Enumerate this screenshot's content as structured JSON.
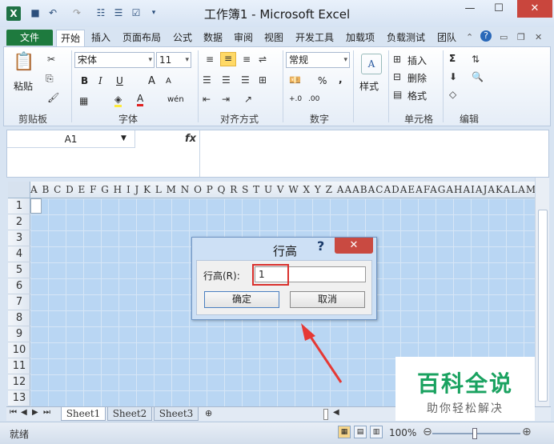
{
  "window": {
    "title": "工作簿1 - Microsoft Excel",
    "minimize": "—",
    "maximize": "☐",
    "close": "✕"
  },
  "quick_access": {
    "save": "💾",
    "undo": "↶",
    "redo": "↷"
  },
  "tabs": [
    "文件",
    "开始",
    "插入",
    "页面布局",
    "公式",
    "数据",
    "审阅",
    "视图",
    "开发工具",
    "加载项",
    "负载测试",
    "团队"
  ],
  "ribbon": {
    "clipboard": {
      "paste": "粘贴",
      "label": "剪贴板"
    },
    "font": {
      "name": "宋体",
      "size": "11",
      "bold": "B",
      "italic": "I",
      "underline": "U",
      "grow": "A",
      "shrink": "A",
      "wen": "wén",
      "label": "字体"
    },
    "alignment": {
      "label": "对齐方式"
    },
    "number": {
      "format": "常规",
      "percent": "%",
      "comma": ",",
      "inc": "+.0",
      "dec": ".00",
      "label": "数字"
    },
    "styles": {
      "label": "样式",
      "icon": "A"
    },
    "cells": {
      "insert": "插入",
      "delete": "删除",
      "format": "格式",
      "label": "单元格"
    },
    "editing": {
      "sum": "Σ",
      "label": "编辑"
    }
  },
  "formula_bar": {
    "name_box": "A1",
    "fx": "fx",
    "value": ""
  },
  "grid": {
    "column_headers": "A B C D E F G H I J K L M N O P Q R S T U V W X Y Z AAABACADAEAFAGAHAIAJAKALAMANAOAPAQARASATA",
    "rows": [
      "1",
      "2",
      "3",
      "4",
      "5",
      "6",
      "7",
      "8",
      "9",
      "10",
      "11",
      "12",
      "13"
    ]
  },
  "sheets": [
    "Sheet1",
    "Sheet2",
    "Sheet3"
  ],
  "status": {
    "text": "就绪",
    "zoom": "100%"
  },
  "dialog": {
    "title": "行高",
    "help": "?",
    "close": "✕",
    "label": "行高(R):",
    "value": "1",
    "ok": "确定",
    "cancel": "取消"
  },
  "watermark": {
    "title": "百科全说",
    "subtitle": "助你轻松解决"
  },
  "colors": {
    "accent_green": "#1e7145",
    "highlight_red": "#d9302c",
    "watermark_green": "#1aa260"
  }
}
